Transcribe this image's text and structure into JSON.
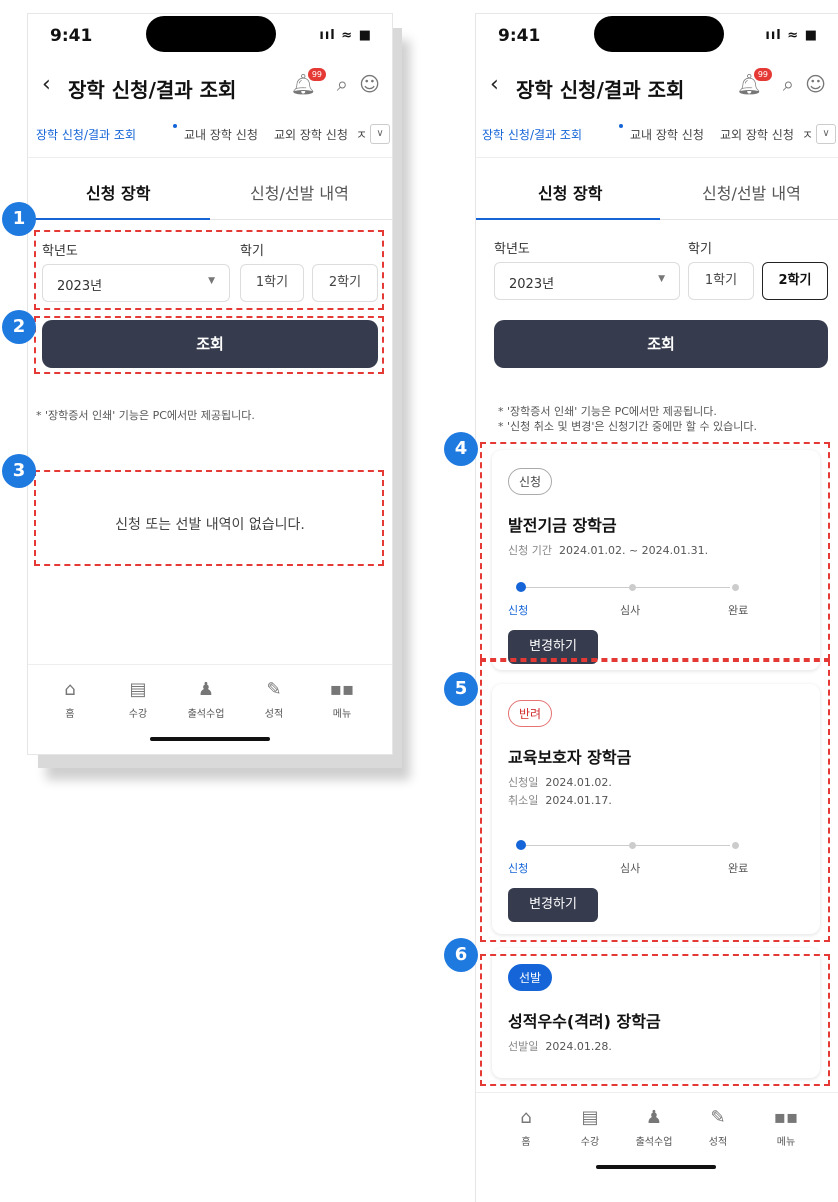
{
  "status": {
    "time": "9:41",
    "signal": "ııl ≈ ■"
  },
  "appbar": {
    "back": "‹",
    "title": "장학 신청/결과 조회",
    "badge": "99",
    "bell_icon": "bell-icon",
    "search_icon": "search-icon",
    "user_icon": "user-icon"
  },
  "subtabs": {
    "items": [
      "장학 신청/결과 조회",
      "교내 장학 신청",
      "교외 장학 신청",
      "ㅈ"
    ],
    "more": "∨"
  },
  "maintabs": {
    "apply": "신청 장학",
    "history": "신청/선발 내역"
  },
  "form": {
    "year_label": "학년도",
    "semester_label": "학기",
    "year_value": "2023년",
    "semester1": "1학기",
    "semester2": "2학기",
    "search_button": "조회"
  },
  "notices": {
    "print": "* '장학증서 인쇄' 기능은 PC에서만 제공됩니다.",
    "cancel": "* '신청 취소 및 변경'은 신청기간 중에만 할 수 있습니다."
  },
  "empty_message": "신청 또는 선발 내역이 없습니다.",
  "steps": [
    "신청",
    "심사",
    "완료"
  ],
  "cards": [
    {
      "status": "신청",
      "title": "발전기금 장학금",
      "meta1_label": "신청 기간",
      "meta1_value": "2024.01.02. ~ 2024.01.31.",
      "button": "변경하기"
    },
    {
      "status": "반려",
      "title": "교육보호자 장학금",
      "meta1_label": "신청일",
      "meta1_value": "2024.01.02.",
      "meta2_label": "취소일",
      "meta2_value": "2024.01.17.",
      "button": "변경하기"
    },
    {
      "status": "선발",
      "title": "성적우수(격려) 장학금",
      "meta1_label": "선발일",
      "meta1_value": "2024.01.28."
    }
  ],
  "bottomnav": [
    {
      "label": "홈",
      "icon": "home-icon",
      "glyph": "⌂"
    },
    {
      "label": "수강",
      "icon": "course-icon",
      "glyph": "▤"
    },
    {
      "label": "출석수업",
      "icon": "attendance-icon",
      "glyph": "♟"
    },
    {
      "label": "성적",
      "icon": "grade-icon",
      "glyph": "✎"
    },
    {
      "label": "메뉴",
      "icon": "menu-grid-icon",
      "glyph": "▪▪"
    }
  ],
  "annotations": [
    "1",
    "2",
    "3",
    "4",
    "5",
    "6"
  ],
  "colors": {
    "primary": "#1565d8",
    "dark_button": "#363b4e",
    "annotation_dash": "#e53935",
    "annotation_marker": "#1f7ae0"
  }
}
